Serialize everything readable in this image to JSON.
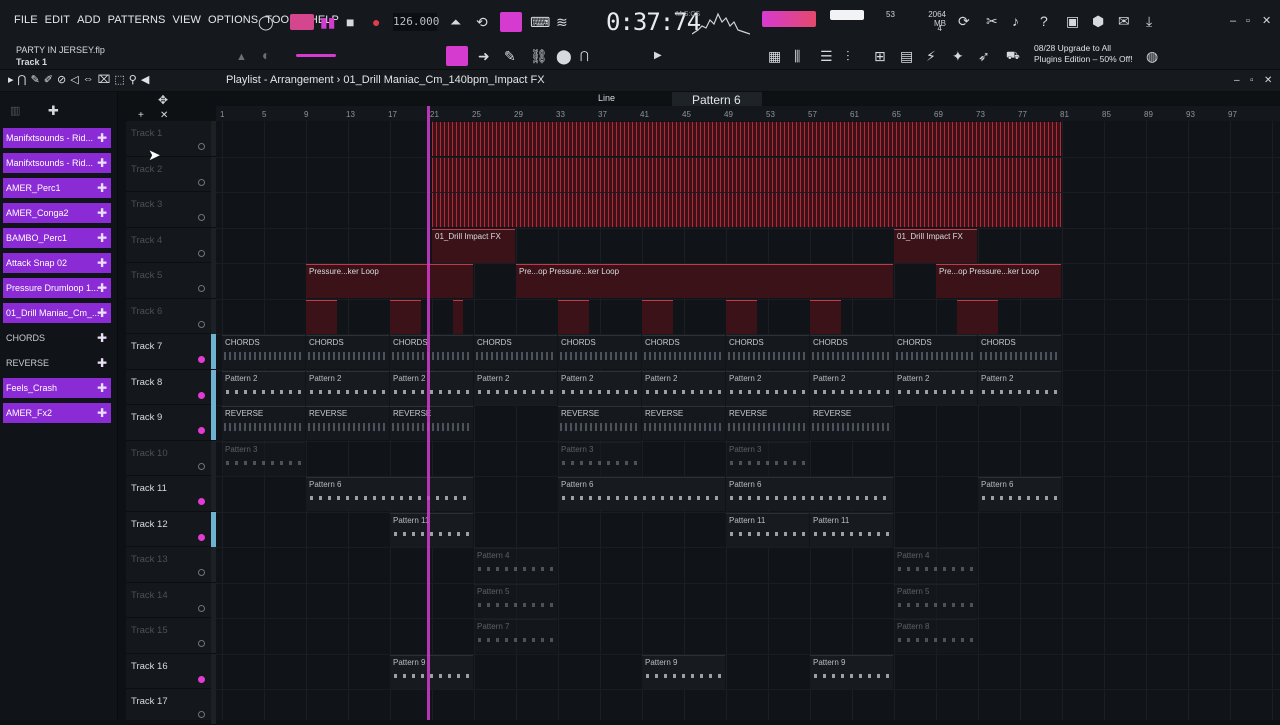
{
  "menu": [
    "FILE",
    "EDIT",
    "ADD",
    "PATTERNS",
    "VIEW",
    "OPTIONS",
    "TOOLS",
    "HELP"
  ],
  "transport": {
    "bpm": "126.000",
    "time": "0:37:74",
    "time_unit": "M:S:CS"
  },
  "stats": {
    "cpu": "53",
    "memory": "2064 MB",
    "voices": "4"
  },
  "project": {
    "file": "PARTY IN JERSEY.flp",
    "focused": "Track 1"
  },
  "toolbar": {
    "snap": "Line",
    "pattern": "Pattern 6"
  },
  "promo": {
    "line1": "08/28  Upgrade to All",
    "line2": "Plugins Edition – 50% Off!"
  },
  "playlist": {
    "title": "Playlist - Arrangement",
    "breadcrumb_sep": "›",
    "sample": "01_Drill Maniac_Cm_140bpm_Impact FX"
  },
  "browser": [
    {
      "label": "Manifxtsounds - Rid...",
      "selected": true
    },
    {
      "label": "Manifxtsounds - Rid...",
      "selected": true
    },
    {
      "label": "AMER_Perc1",
      "selected": true
    },
    {
      "label": "AMER_Conga2",
      "selected": true
    },
    {
      "label": "BAMBO_Perc1",
      "selected": true
    },
    {
      "label": "Attack Snap 02",
      "selected": true
    },
    {
      "label": "Pressure Drumloop 1...",
      "selected": true
    },
    {
      "label": "01_Drill Maniac_Cm_...",
      "selected": true
    },
    {
      "label": "CHORDS",
      "selected": false
    },
    {
      "label": "REVERSE",
      "selected": false
    },
    {
      "label": "Feels_Crash",
      "selected": true
    },
    {
      "label": "AMER_Fx2",
      "selected": true
    }
  ],
  "ruler": [
    "1",
    "5",
    "9",
    "13",
    "17",
    "21",
    "25",
    "29",
    "33",
    "37",
    "41",
    "45",
    "49",
    "53",
    "57",
    "61",
    "65",
    "69",
    "73",
    "77",
    "81",
    "85",
    "89",
    "93",
    "97"
  ],
  "tracks": [
    {
      "name": "Track 1",
      "dim": true,
      "on": false,
      "vol": false
    },
    {
      "name": "Track 2",
      "dim": true,
      "on": false,
      "vol": false
    },
    {
      "name": "Track 3",
      "dim": true,
      "on": false,
      "vol": false
    },
    {
      "name": "Track 4",
      "dim": true,
      "on": false,
      "vol": false
    },
    {
      "name": "Track 5",
      "dim": true,
      "on": false,
      "vol": false
    },
    {
      "name": "Track 6",
      "dim": true,
      "on": false,
      "vol": false
    },
    {
      "name": "Track 7",
      "dim": false,
      "on": true,
      "vol": true
    },
    {
      "name": "Track 8",
      "dim": false,
      "on": true,
      "vol": true
    },
    {
      "name": "Track 9",
      "dim": false,
      "on": true,
      "vol": true
    },
    {
      "name": "Track 10",
      "dim": true,
      "on": false,
      "vol": false
    },
    {
      "name": "Track 11",
      "dim": false,
      "on": true,
      "vol": false
    },
    {
      "name": "Track 12",
      "dim": false,
      "on": true,
      "vol": true
    },
    {
      "name": "Track 13",
      "dim": true,
      "on": false,
      "vol": false
    },
    {
      "name": "Track 14",
      "dim": true,
      "on": false,
      "vol": false
    },
    {
      "name": "Track 15",
      "dim": true,
      "on": false,
      "vol": false
    },
    {
      "name": "Track 16",
      "dim": false,
      "on": true,
      "vol": false
    },
    {
      "name": "Track 17",
      "dim": false,
      "on": false,
      "vol": false
    }
  ],
  "clips": [
    {
      "track": 0,
      "bar": 21,
      "len": 60,
      "style": "redfill",
      "label": ""
    },
    {
      "track": 1,
      "bar": 21,
      "len": 60,
      "style": "redfill",
      "label": ""
    },
    {
      "track": 2,
      "bar": 21,
      "len": 60,
      "style": "redfill",
      "label": ""
    },
    {
      "track": 3,
      "bar": 21,
      "len": 8,
      "style": "red",
      "label": "01_Drill Impact FX"
    },
    {
      "track": 3,
      "bar": 65,
      "len": 8,
      "style": "red",
      "label": "01_Drill Impact FX"
    },
    {
      "track": 4,
      "bar": 9,
      "len": 16,
      "style": "red",
      "label": "Pressure...ker Loop"
    },
    {
      "track": 4,
      "bar": 29,
      "len": 36,
      "style": "red",
      "label": "Pre...op  Pressure...ker Loop"
    },
    {
      "track": 4,
      "bar": 69,
      "len": 12,
      "style": "red",
      "label": "Pre...op  Pressure...ker Loop"
    },
    {
      "track": 5,
      "bar": 9,
      "len": 3,
      "style": "red",
      "label": ""
    },
    {
      "track": 5,
      "bar": 17,
      "len": 3,
      "style": "red",
      "label": ""
    },
    {
      "track": 5,
      "bar": 23,
      "len": 1,
      "style": "red",
      "label": ""
    },
    {
      "track": 5,
      "bar": 33,
      "len": 3,
      "style": "red",
      "label": ""
    },
    {
      "track": 5,
      "bar": 41,
      "len": 3,
      "style": "red",
      "label": ""
    },
    {
      "track": 5,
      "bar": 49,
      "len": 3,
      "style": "red",
      "label": ""
    },
    {
      "track": 5,
      "bar": 57,
      "len": 3,
      "style": "red",
      "label": ""
    },
    {
      "track": 5,
      "bar": 71,
      "len": 4,
      "style": "red",
      "label": ""
    },
    {
      "track": 6,
      "bar": 1,
      "len": 8,
      "style": "chords",
      "label": "CHORDS"
    },
    {
      "track": 6,
      "bar": 9,
      "len": 8,
      "style": "chords",
      "label": "CHORDS"
    },
    {
      "track": 6,
      "bar": 17,
      "len": 8,
      "style": "chords",
      "label": "CHORDS"
    },
    {
      "track": 6,
      "bar": 25,
      "len": 8,
      "style": "chords",
      "label": "CHORDS"
    },
    {
      "track": 6,
      "bar": 33,
      "len": 8,
      "style": "chords",
      "label": "CHORDS"
    },
    {
      "track": 6,
      "bar": 41,
      "len": 8,
      "style": "chords",
      "label": "CHORDS"
    },
    {
      "track": 6,
      "bar": 49,
      "len": 8,
      "style": "chords",
      "label": "CHORDS"
    },
    {
      "track": 6,
      "bar": 57,
      "len": 8,
      "style": "chords",
      "label": "CHORDS"
    },
    {
      "track": 6,
      "bar": 65,
      "len": 8,
      "style": "chords",
      "label": "CHORDS"
    },
    {
      "track": 6,
      "bar": 73,
      "len": 8,
      "style": "chords",
      "label": "CHORDS"
    },
    {
      "track": 7,
      "bar": 1,
      "len": 8,
      "style": "gray",
      "label": "Pattern 2"
    },
    {
      "track": 7,
      "bar": 9,
      "len": 8,
      "style": "gray",
      "label": "Pattern 2"
    },
    {
      "track": 7,
      "bar": 17,
      "len": 8,
      "style": "gray",
      "label": "Pattern 2"
    },
    {
      "track": 7,
      "bar": 25,
      "len": 8,
      "style": "gray",
      "label": "Pattern 2"
    },
    {
      "track": 7,
      "bar": 33,
      "len": 8,
      "style": "gray",
      "label": "Pattern 2"
    },
    {
      "track": 7,
      "bar": 41,
      "len": 8,
      "style": "gray",
      "label": "Pattern 2"
    },
    {
      "track": 7,
      "bar": 49,
      "len": 8,
      "style": "gray",
      "label": "Pattern 2"
    },
    {
      "track": 7,
      "bar": 57,
      "len": 8,
      "style": "gray",
      "label": "Pattern 2"
    },
    {
      "track": 7,
      "bar": 65,
      "len": 8,
      "style": "gray",
      "label": "Pattern 2"
    },
    {
      "track": 7,
      "bar": 73,
      "len": 8,
      "style": "gray",
      "label": "Pattern 2"
    },
    {
      "track": 8,
      "bar": 1,
      "len": 8,
      "style": "chords",
      "label": "REVERSE"
    },
    {
      "track": 8,
      "bar": 9,
      "len": 8,
      "style": "chords",
      "label": "REVERSE"
    },
    {
      "track": 8,
      "bar": 17,
      "len": 8,
      "style": "chords",
      "label": "REVERSE"
    },
    {
      "track": 8,
      "bar": 33,
      "len": 8,
      "style": "chords",
      "label": "REVERSE"
    },
    {
      "track": 8,
      "bar": 41,
      "len": 8,
      "style": "chords",
      "label": "REVERSE"
    },
    {
      "track": 8,
      "bar": 49,
      "len": 8,
      "style": "chords",
      "label": "REVERSE"
    },
    {
      "track": 8,
      "bar": 57,
      "len": 8,
      "style": "chords",
      "label": "REVERSE"
    },
    {
      "track": 9,
      "bar": 1,
      "len": 8,
      "style": "gray dimclip",
      "label": "Pattern 3"
    },
    {
      "track": 9,
      "bar": 33,
      "len": 8,
      "style": "gray dimclip",
      "label": "Pattern 3"
    },
    {
      "track": 9,
      "bar": 49,
      "len": 8,
      "style": "gray dimclip",
      "label": "Pattern 3"
    },
    {
      "track": 10,
      "bar": 9,
      "len": 16,
      "style": "gray",
      "label": "Pattern 6"
    },
    {
      "track": 10,
      "bar": 33,
      "len": 16,
      "style": "gray",
      "label": "Pattern 6"
    },
    {
      "track": 10,
      "bar": 49,
      "len": 16,
      "style": "gray",
      "label": "Pattern 6"
    },
    {
      "track": 10,
      "bar": 73,
      "len": 8,
      "style": "gray",
      "label": "Pattern 6"
    },
    {
      "track": 11,
      "bar": 17,
      "len": 8,
      "style": "gray",
      "label": "Pattern 11"
    },
    {
      "track": 11,
      "bar": 49,
      "len": 8,
      "style": "gray",
      "label": "Pattern 11"
    },
    {
      "track": 11,
      "bar": 57,
      "len": 8,
      "style": "gray",
      "label": "Pattern 11"
    },
    {
      "track": 12,
      "bar": 25,
      "len": 8,
      "style": "gray dimclip",
      "label": "Pattern 4"
    },
    {
      "track": 12,
      "bar": 65,
      "len": 8,
      "style": "gray dimclip",
      "label": "Pattern 4"
    },
    {
      "track": 13,
      "bar": 25,
      "len": 8,
      "style": "gray dimclip",
      "label": "Pattern 5"
    },
    {
      "track": 13,
      "bar": 65,
      "len": 8,
      "style": "gray dimclip",
      "label": "Pattern 5"
    },
    {
      "track": 14,
      "bar": 25,
      "len": 8,
      "style": "gray dimclip",
      "label": "Pattern 7"
    },
    {
      "track": 14,
      "bar": 65,
      "len": 8,
      "style": "gray dimclip",
      "label": "Pattern 8"
    },
    {
      "track": 15,
      "bar": 17,
      "len": 8,
      "style": "gray",
      "label": "Pattern 9"
    },
    {
      "track": 15,
      "bar": 41,
      "len": 8,
      "style": "gray",
      "label": "Pattern 9"
    },
    {
      "track": 15,
      "bar": 57,
      "len": 8,
      "style": "gray",
      "label": "Pattern 9"
    }
  ],
  "colors": {
    "accent": "#d63bd0",
    "browser_sel": "#8a2bd6",
    "clip_red": "#b6283a",
    "volume": "#6fb2cf"
  }
}
